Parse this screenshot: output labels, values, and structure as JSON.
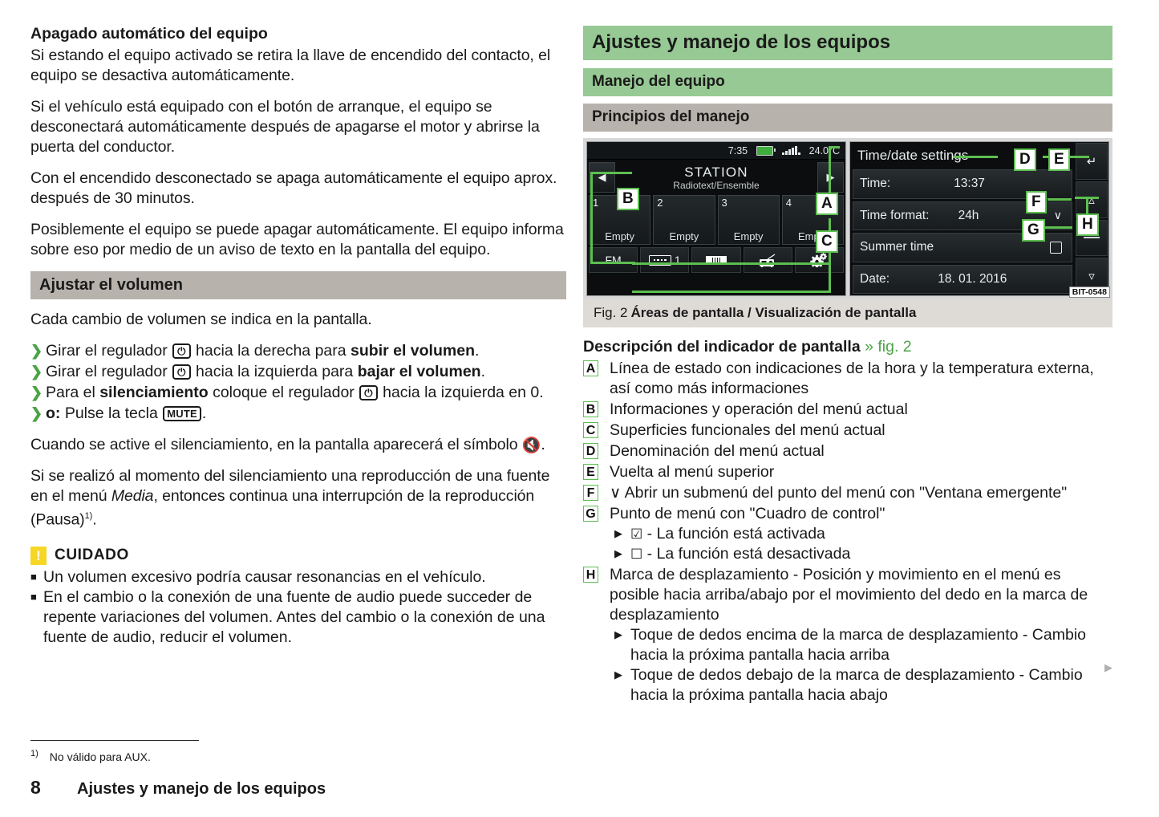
{
  "left_column": {
    "section1_heading": "Apagado automático del equipo",
    "section1_paragraphs": [
      "Si estando el equipo activado se retira la llave de encendido del contacto, el equipo se desactiva automáticamente.",
      "Si el vehículo está equipado con el botón de arranque, el equipo se desconectará automáticamente después de apagarse el motor y abrirse la puerta del conductor.",
      "Con el encendido desconectado se apaga automáticamente el equipo aprox. después de 30 minutos.",
      "Posiblemente el equipo se puede apagar automáticamente. El equipo informa sobre eso por medio de un aviso de texto en la pantalla del equipo."
    ],
    "section2_bar_title": "Ajustar el volumen",
    "section2_intro": "Cada cambio de volumen se indica en la pantalla.",
    "bullets": [
      {
        "pre": "Girar el regulador ",
        "icon": "volume-knob-icon",
        "icon_glyph": "⏻",
        "mid": " hacia la derecha para ",
        "bold": "subir el volumen",
        "post": "."
      },
      {
        "pre": "Girar el regulador ",
        "icon": "volume-knob-icon",
        "icon_glyph": "⏻",
        "mid": " hacia la izquierda para ",
        "bold": "bajar el volumen",
        "post": "."
      },
      {
        "pre": "Para el ",
        "bold_lead": "silenciamiento",
        "mid_lead": " coloque el regulador ",
        "icon": "volume-knob-icon",
        "icon_glyph": "⏻",
        "post": " hacia la izquierda en 0."
      },
      {
        "bold_lead": "o:",
        "mid_lead": " Pulse la tecla ",
        "icon": "mute-key-icon",
        "key_label": "MUTE",
        "post": "."
      }
    ],
    "after_bullets_paragraph_pre": "Cuando se active el silenciamiento, en la pantalla aparecerá el símbolo ",
    "after_bullets_symbol": "🔇",
    "after_bullets_paragraph_post": ".",
    "media_paragraph_1": "Si se realizó al momento del silenciamiento una reproducción de una fuente en el menú ",
    "media_italic": "Media",
    "media_paragraph_2": ", entonces continua una interrupción de la reproducción (Pausa)",
    "media_footnote_marker": "1)",
    "media_paragraph_3": ".",
    "caution_title": "CUIDADO",
    "caution_icon_glyph": "!",
    "caution_items": [
      "Un volumen excesivo podría causar resonancias en el vehículo.",
      "En el cambio o la conexión de una fuente de audio puede succeder de repente variaciones del volumen. Antes del cambio o la conexión de una fuente de audio, reducir el volumen."
    ]
  },
  "footnote": {
    "marker": "1)",
    "text": "No válido para AUX."
  },
  "footer": {
    "page_number": "8",
    "title": "Ajustes y manejo de los equipos"
  },
  "right_column": {
    "main_heading": "Ajustes y manejo de los equipos",
    "sub_heading_green": "Manejo del equipo",
    "sub_heading_gray": "Principios del manejo",
    "figure": {
      "caption_number": "Fig. 2",
      "caption_text": "Áreas de pantalla / Visualización de pantalla",
      "image_code": "BIT-0548",
      "radio_screen": {
        "status_time": "7:35",
        "status_battery_icon": "battery-icon",
        "status_signal_icon": "signal-bars-icon",
        "status_temperature": "24.0°C",
        "prev_arrow": "◀",
        "next_arrow": "▶",
        "station_name": "STATION",
        "station_subtitle": "Radiotext/Ensemble",
        "presets": [
          {
            "number": "1",
            "label": "Empty"
          },
          {
            "number": "2",
            "label": "Empty"
          },
          {
            "number": "3",
            "label": "Empty"
          },
          {
            "number": "4",
            "label": "Empty"
          }
        ],
        "toolbar": [
          {
            "name": "band-button",
            "label": "FM"
          },
          {
            "name": "preset-list-button",
            "label": "1"
          },
          {
            "name": "frequency-scale-button",
            "label": ""
          },
          {
            "name": "radio-source-button",
            "label": ""
          },
          {
            "name": "settings-gear-button",
            "label": ""
          }
        ]
      },
      "settings_screen": {
        "title": "Time/date settings",
        "back_icon": "back-arrow-icon",
        "up_icon": "chevron-up-icon",
        "down_icon": "chevron-down-icon",
        "scroll_mark_icon": "scroll-mark-icon",
        "rows": [
          {
            "label": "Time:",
            "value": "13:37",
            "control": "none"
          },
          {
            "label": "Time format:",
            "value": "24h",
            "control": "chevron-down"
          },
          {
            "label": "Summer time",
            "value": "",
            "control": "checkbox"
          },
          {
            "label": "Date:",
            "value": "18. 01. 2016",
            "control": "none"
          }
        ]
      },
      "callouts": [
        "A",
        "B",
        "C",
        "D",
        "E",
        "F",
        "G",
        "H"
      ]
    },
    "description_heading": "Descripción del indicador de pantalla",
    "description_reference": "» fig. 2",
    "legend": [
      {
        "key": "A",
        "text": "Línea de estado con indicaciones de la hora y la temperatura externa, así como más informaciones"
      },
      {
        "key": "B",
        "text": "Informaciones y operación del menú actual"
      },
      {
        "key": "C",
        "text": "Superficies funcionales del menú actual"
      },
      {
        "key": "D",
        "text": "Denominación del menú actual"
      },
      {
        "key": "E",
        "text": "Vuelta al menú superior"
      },
      {
        "key": "F",
        "text": "∨ Abrir un submenú del punto del menú con \"Ventana emergente\""
      },
      {
        "key": "G",
        "text": "Punto de menú con \"Cuadro de control\"",
        "sub_items": [
          {
            "glyph": "☑",
            "text": " - La función está activada"
          },
          {
            "glyph": "☐",
            "text": " - La función está desactivada"
          }
        ]
      },
      {
        "key": "H",
        "text": "Marca de desplazamiento - Posición y movimiento en el menú es posible hacia arriba/abajo por el movimiento del dedo en la marca de desplazamiento",
        "sub_items": [
          {
            "glyph": "",
            "text": "Toque de dedos encima de la marca de desplazamiento - Cambio hacia la próxima pantalla hacia arriba"
          },
          {
            "glyph": "",
            "text": "Toque de dedos debajo de la marca de desplazamiento - Cambio hacia la próxima pantalla hacia abajo"
          }
        ]
      }
    ],
    "continuation_marker": "▶"
  },
  "colors": {
    "green_header": "#97c994",
    "gray_header": "#b8b2ac",
    "accent_green": "#4ba346",
    "callout_green": "#5cbf4f",
    "caution_yellow": "#f7d726",
    "caption_gray": "#dedbd7"
  }
}
